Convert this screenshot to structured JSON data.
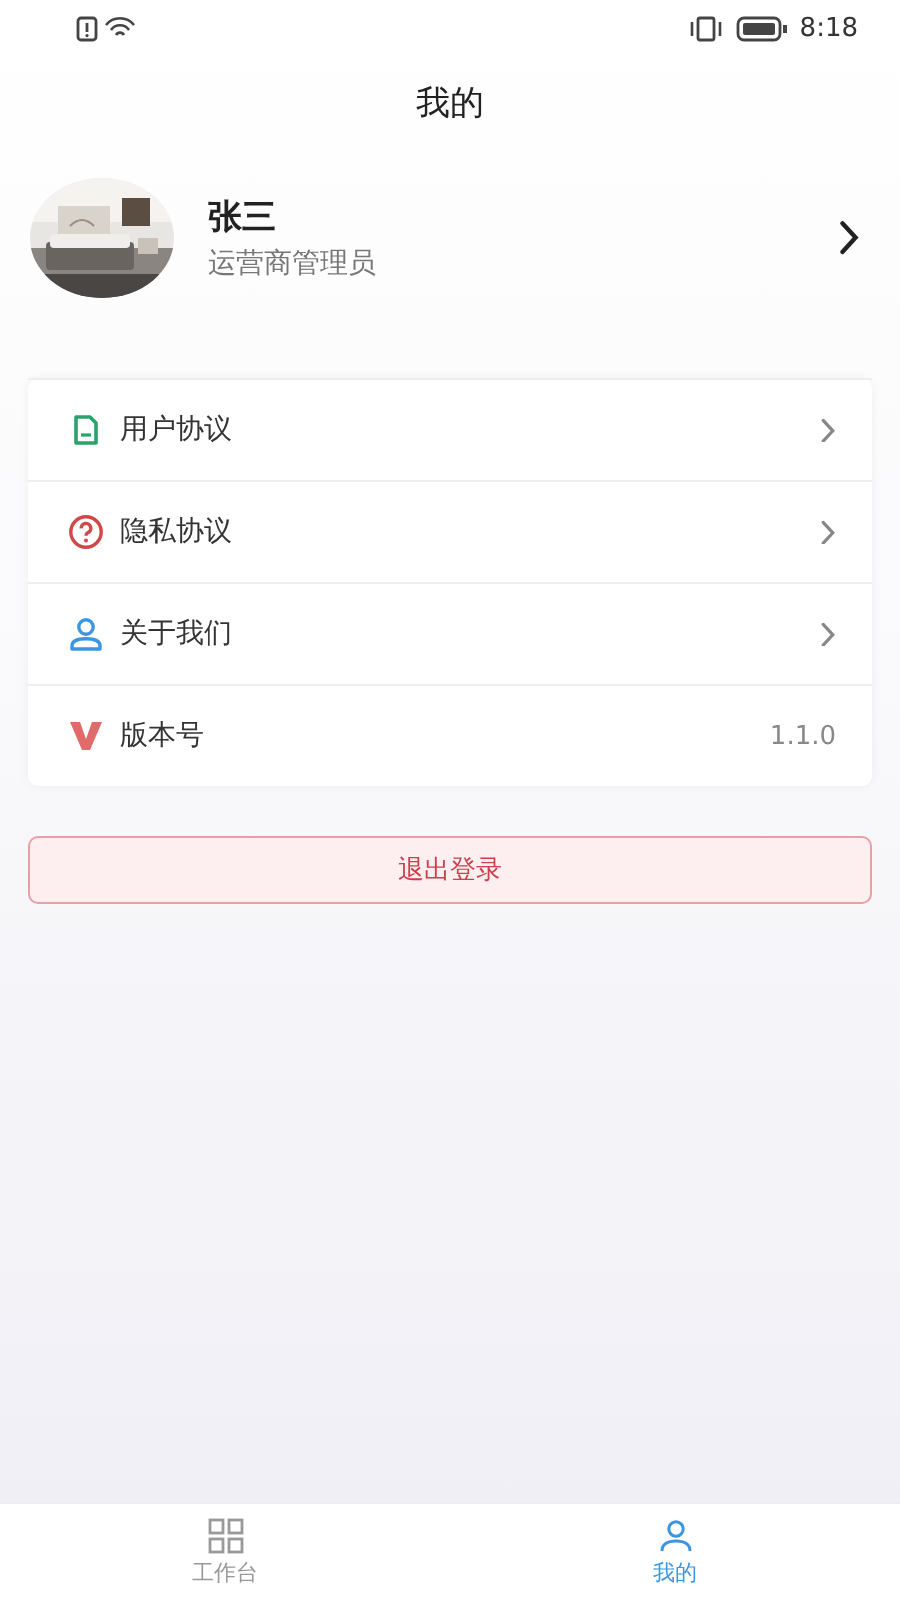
{
  "status_bar": {
    "time": "8:18"
  },
  "header": {
    "title": "我的"
  },
  "profile": {
    "name": "张三",
    "role": "运营商管理员"
  },
  "menu": [
    {
      "kind": "link",
      "label": "用户协议"
    },
    {
      "kind": "link",
      "label": "隐私协议"
    },
    {
      "kind": "link",
      "label": "关于我们"
    },
    {
      "kind": "value",
      "label": "版本号",
      "value": "1.1.0"
    }
  ],
  "logout_button": {
    "label": "退出登录"
  },
  "tab_bar": [
    {
      "label": "工作台",
      "selected": false
    },
    {
      "label": "我的",
      "selected": true
    }
  ]
}
